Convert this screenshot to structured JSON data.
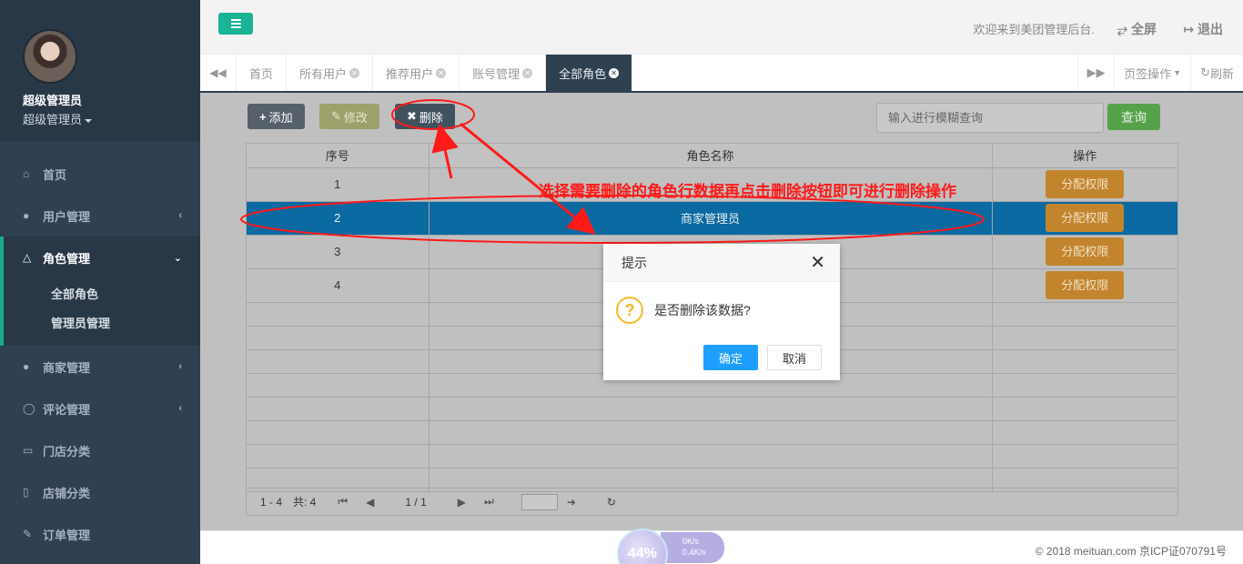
{
  "sidebar": {
    "user_name": "超级管理员",
    "user_role": "超级管理员",
    "items": [
      {
        "label": "首页",
        "icon": "home-icon"
      },
      {
        "label": "用户管理",
        "icon": "user-icon"
      },
      {
        "label": "角色管理",
        "icon": "flask-icon",
        "sub": [
          "全部角色",
          "管理员管理"
        ]
      },
      {
        "label": "商家管理",
        "icon": "user-plus-icon"
      },
      {
        "label": "评论管理",
        "icon": "comment-icon"
      },
      {
        "label": "门店分类",
        "icon": "desktop-icon"
      },
      {
        "label": "店铺分类",
        "icon": "file-icon"
      },
      {
        "label": "订单管理",
        "icon": "edit-icon"
      }
    ]
  },
  "header": {
    "welcome": "欢迎来到美团管理后台.",
    "fullscreen": "全屏",
    "logout": "退出"
  },
  "tabs": {
    "items": [
      "首页",
      "所有用户",
      "推荐用户",
      "账号管理",
      "全部角色"
    ],
    "active": "全部角色",
    "tab_ops": "页签操作",
    "refresh": "刷新"
  },
  "toolbar": {
    "add": "添加",
    "edit": "修改",
    "delete": "删除",
    "search_placeholder": "输入进行模糊查询",
    "search": "查询"
  },
  "table": {
    "columns": [
      "序号",
      "角色名称",
      "操作"
    ],
    "rows": [
      {
        "index": "1",
        "name": "",
        "action": "分配权限"
      },
      {
        "index": "2",
        "name": "商家管理员",
        "action": "分配权限"
      },
      {
        "index": "3",
        "name": "",
        "action": "分配权限"
      },
      {
        "index": "4",
        "name": "",
        "action": "分配权限"
      }
    ],
    "selected_row": 2
  },
  "pager": {
    "range": "1 - 4",
    "total": "共: 4",
    "page": "1 / 1"
  },
  "annotation": {
    "text": "选择需要删除的角色行数据再点击删除按钮即可进行删除操作",
    "color": "#ff1a1a"
  },
  "dialog": {
    "title": "提示",
    "message": "是否删除该数据?",
    "ok": "确定",
    "cancel": "取消"
  },
  "footer": {
    "copyright": "© 2018 meituan.com 京ICP证070791号",
    "net_percent": "44%",
    "net_up": "0K/s",
    "net_down": "0.4K/s"
  },
  "colors": {
    "sidebar": "#2f4050",
    "accent": "#1ab394",
    "selected_row": "#0b6aa1",
    "assign_button": "#c2852d",
    "dialog_ok": "#1e9fff"
  }
}
